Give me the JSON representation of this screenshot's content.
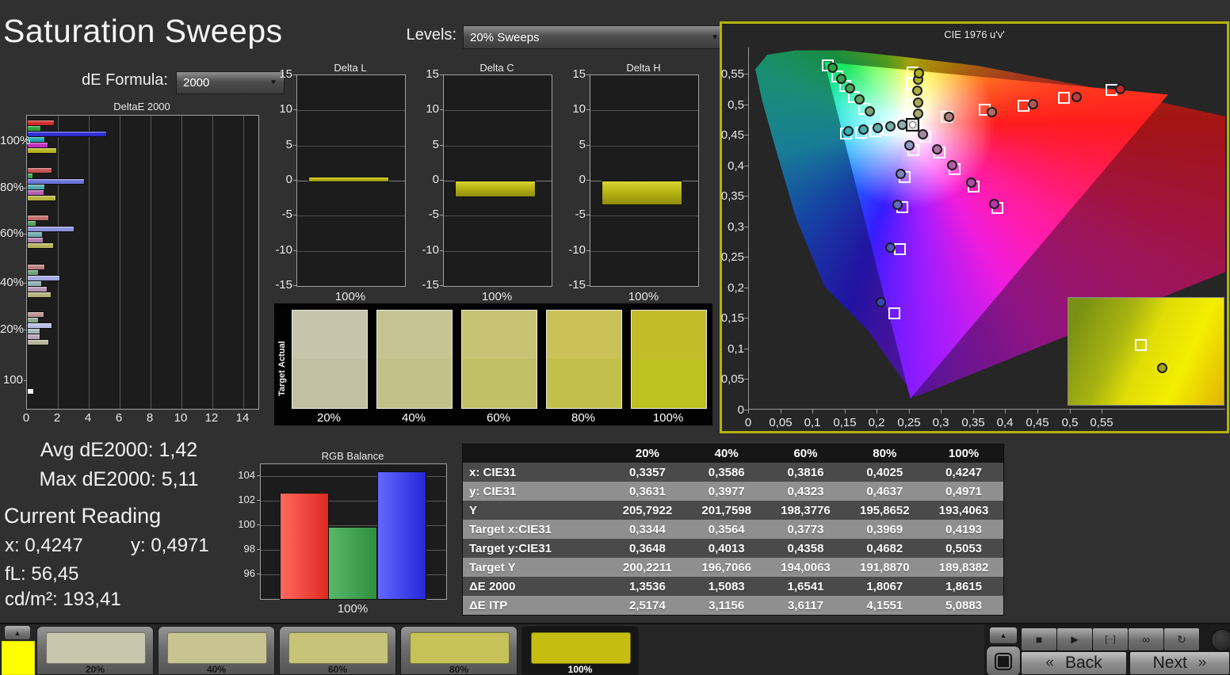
{
  "app": {
    "title": "Saturation Sweeps"
  },
  "controls": {
    "de_formula": {
      "label": "dE Formula:",
      "value": "2000"
    },
    "levels": {
      "label": "Levels:",
      "value": "20% Sweeps"
    }
  },
  "stats": {
    "avg": "Avg dE2000: 1,42",
    "max": "Max dE2000: 5,11",
    "current_reading": "Current Reading",
    "x_value": "x: 0,4247",
    "y_value": "y: 0,4971",
    "fl": "fL: 56,45",
    "cdm2": "cd/m²: 193,41"
  },
  "swatch_panel": {
    "row_labels": [
      "Actual",
      "Target"
    ],
    "columns": [
      {
        "label": "20%",
        "actual": "#c6c4ab",
        "target": "#c1c0a2"
      },
      {
        "label": "40%",
        "actual": "#c6c492",
        "target": "#c2c189"
      },
      {
        "label": "60%",
        "actual": "#c8c374",
        "target": "#c1c067"
      },
      {
        "label": "80%",
        "actual": "#cac256",
        "target": "#c2c04a"
      },
      {
        "label": "100%",
        "actual": "#c3bc2a",
        "target": "#bfc021"
      }
    ]
  },
  "table": {
    "col_headers": [
      "20%",
      "40%",
      "60%",
      "80%",
      "100%"
    ],
    "rows": [
      {
        "label": "x: CIE31",
        "values": [
          "0,3357",
          "0,3586",
          "0,3816",
          "0,4025",
          "0,4247"
        ]
      },
      {
        "label": "y: CIE31",
        "values": [
          "0,3631",
          "0,3977",
          "0,4323",
          "0,4637",
          "0,4971"
        ]
      },
      {
        "label": "Y",
        "values": [
          "205,7922",
          "201,7598",
          "198,3776",
          "195,8652",
          "193,4063"
        ]
      },
      {
        "label": "Target x:CIE31",
        "values": [
          "0,3344",
          "0,3564",
          "0,3773",
          "0,3969",
          "0,4193"
        ]
      },
      {
        "label": "Target y:CIE31",
        "values": [
          "0,3648",
          "0,4013",
          "0,4358",
          "0,4682",
          "0,5053"
        ]
      },
      {
        "label": "Target Y",
        "values": [
          "200,2211",
          "196,7066",
          "194,0063",
          "191,8870",
          "189,8382"
        ]
      },
      {
        "label": "ΔE 2000",
        "values": [
          "1,3536",
          "1,5083",
          "1,6541",
          "1,8067",
          "1,8615"
        ]
      },
      {
        "label": "ΔE ITP",
        "values": [
          "2,5174",
          "3,1156",
          "3,6117",
          "4,1551",
          "5,0883"
        ]
      }
    ]
  },
  "bottom_bar": {
    "current_color": "#ffff00",
    "tiles": [
      {
        "label": "20%",
        "color": "#c7c5ab",
        "selected": false
      },
      {
        "label": "40%",
        "color": "#c7c492",
        "selected": false
      },
      {
        "label": "60%",
        "color": "#c7c379",
        "selected": false
      },
      {
        "label": "80%",
        "color": "#c6c158",
        "selected": false
      },
      {
        "label": "100%",
        "color": "#c6bd12",
        "selected": true
      }
    ]
  },
  "transport": {
    "icons": [
      "stop",
      "play",
      "range",
      "infinity",
      "refresh"
    ],
    "glyphs": {
      "stop": "■",
      "play": "▶",
      "range": "[··]",
      "infinity": "∞",
      "refresh": "↻",
      "arrow_up": "▲"
    },
    "back_label": "Back",
    "next_label": "Next",
    "back_chevron": "«",
    "next_chevron": "»"
  },
  "chart_data": [
    {
      "id": "deltae2000",
      "type": "bar",
      "orientation": "horizontal",
      "title": "DeltaE 2000",
      "xlim": [
        0,
        15
      ],
      "xticks": [
        0,
        2,
        4,
        6,
        8,
        10,
        12,
        14
      ],
      "series_names": [
        "Red",
        "Green",
        "Blue",
        "Cyan",
        "Magenta",
        "Yellow"
      ],
      "groups": [
        {
          "label": "100%",
          "values": [
            1.7,
            0.8,
            5.11,
            1.1,
            1.3,
            1.85
          ],
          "colors": [
            "#d02c2c",
            "#2ca23c",
            "#2c2cd0",
            "#20a8b0",
            "#c02cc0",
            "#b6b31e"
          ]
        },
        {
          "label": "80%",
          "values": [
            1.55,
            0.3,
            3.65,
            1.1,
            1.05,
            1.8
          ],
          "colors": [
            "#c25454",
            "#3da04e",
            "#6b74d8",
            "#4faab0",
            "#b45cb4",
            "#b5b23c"
          ]
        },
        {
          "label": "60%",
          "values": [
            1.35,
            0.5,
            3.0,
            0.95,
            1.0,
            1.65
          ],
          "colors": [
            "#c06a6a",
            "#55a060",
            "#8a90dc",
            "#72acb0",
            "#b07cb0",
            "#b5b25c"
          ]
        },
        {
          "label": "40%",
          "values": [
            1.1,
            0.65,
            2.05,
            0.85,
            1.25,
            1.5
          ],
          "colors": [
            "#bd8080",
            "#6fa377",
            "#a3a8e0",
            "#8fb0b2",
            "#b493b4",
            "#b6b37c"
          ]
        },
        {
          "label": "20%",
          "values": [
            1.05,
            0.65,
            1.55,
            0.75,
            0.75,
            1.35
          ],
          "colors": [
            "#bb9494",
            "#8aa68e",
            "#b8bce4",
            "#a8b4b5",
            "#b5a6b5",
            "#b7b49a"
          ]
        },
        {
          "label": "100",
          "values": [
            0.35
          ],
          "colors": [
            "#f2f2f2"
          ]
        }
      ]
    },
    {
      "id": "delta_l",
      "type": "bar",
      "title": "Delta L",
      "categories": [
        "100%"
      ],
      "values": [
        0.55
      ],
      "ylim": [
        -15,
        15
      ],
      "yticks": [
        15,
        10,
        5,
        0,
        -5,
        -10,
        -15
      ],
      "bar_color": "#b9b61d"
    },
    {
      "id": "delta_c",
      "type": "bar",
      "title": "Delta C",
      "categories": [
        "100%"
      ],
      "values": [
        -2.1
      ],
      "ylim": [
        -15,
        15
      ],
      "yticks": [
        15,
        10,
        5,
        0,
        -5,
        -10,
        -15
      ],
      "bar_color": "#b9b61d"
    },
    {
      "id": "delta_h",
      "type": "bar",
      "title": "Delta H",
      "categories": [
        "100%"
      ],
      "values": [
        -3.3
      ],
      "ylim": [
        -15,
        15
      ],
      "yticks": [
        15,
        10,
        5,
        0,
        -5,
        -10,
        -15
      ],
      "bar_color": "#b9b61d"
    },
    {
      "id": "rgb_balance",
      "type": "bar",
      "title": "RGB Balance",
      "categories": [
        "100%"
      ],
      "ylim": [
        94,
        105
      ],
      "yticks": [
        104,
        102,
        100,
        98,
        96
      ],
      "series": [
        {
          "name": "Red",
          "value": 102.7,
          "color": "#ff6a5e",
          "color2": "#e02a22"
        },
        {
          "name": "Green",
          "value": 99.9,
          "color": "#58b868",
          "color2": "#2f8f40"
        },
        {
          "name": "Blue",
          "value": 104.4,
          "color": "#6468ff",
          "color2": "#2626d8"
        }
      ]
    },
    {
      "id": "cie1976",
      "type": "scatter",
      "title": "CIE 1976 u'v'",
      "xticks": [
        "0",
        "0,05",
        "0,1",
        "0,15",
        "0,2",
        "0,25",
        "0,3",
        "0,35",
        "0,4",
        "0,45",
        "0,5",
        "0,55"
      ],
      "yticks": [
        "0",
        "0,05",
        "0,1",
        "0,15",
        "0,2",
        "0,25",
        "0,3",
        "0,35",
        "0,4",
        "0,45",
        "0,5",
        "0,55"
      ],
      "tick_step": 0.05,
      "white_point": {
        "u": 0.255,
        "v": 0.467
      },
      "sweeps": [
        {
          "name": "red",
          "targets": [
            [
              0.308,
              0.48
            ],
            [
              0.367,
              0.492
            ],
            [
              0.428,
              0.498
            ],
            [
              0.491,
              0.511
            ],
            [
              0.565,
              0.524
            ]
          ],
          "measured": [
            [
              0.312,
              0.48
            ],
            [
              0.379,
              0.488
            ],
            [
              0.443,
              0.501
            ],
            [
              0.51,
              0.512
            ],
            [
              0.578,
              0.525
            ]
          ],
          "colors": [
            "#b08080",
            "#b46a6a",
            "#b85454",
            "#bc3e3e",
            "#c02828"
          ]
        },
        {
          "name": "green",
          "targets": [
            [
              0.18,
              0.493
            ],
            [
              0.164,
              0.512
            ],
            [
              0.15,
              0.531
            ],
            [
              0.138,
              0.546
            ],
            [
              0.123,
              0.564
            ]
          ],
          "measured": [
            [
              0.189,
              0.489
            ],
            [
              0.173,
              0.508
            ],
            [
              0.158,
              0.527
            ],
            [
              0.144,
              0.542
            ],
            [
              0.131,
              0.56
            ]
          ],
          "colors": [
            "#7ca477",
            "#63a468",
            "#4aa25a",
            "#37a34e",
            "#2aa344"
          ]
        },
        {
          "name": "blue",
          "targets": [
            [
              0.256,
              0.425
            ],
            [
              0.243,
              0.381
            ],
            [
              0.239,
              0.332
            ],
            [
              0.236,
              0.263
            ],
            [
              0.227,
              0.158
            ]
          ],
          "measured": [
            [
              0.25,
              0.433
            ],
            [
              0.237,
              0.387
            ],
            [
              0.232,
              0.336
            ],
            [
              0.221,
              0.266
            ],
            [
              0.206,
              0.176
            ]
          ],
          "colors": [
            "#9298c4",
            "#7a82c2",
            "#626cc0",
            "#4c58be",
            "#3846bc"
          ]
        },
        {
          "name": "cyan",
          "targets": [
            [
              0.236,
              0.463
            ],
            [
              0.217,
              0.459
            ],
            [
              0.197,
              0.457
            ],
            [
              0.175,
              0.454
            ],
            [
              0.152,
              0.453
            ]
          ],
          "measured": [
            [
              0.239,
              0.467
            ],
            [
              0.221,
              0.464
            ],
            [
              0.201,
              0.462
            ],
            [
              0.179,
              0.459
            ],
            [
              0.155,
              0.457
            ]
          ],
          "colors": [
            "#8fb0ac",
            "#79b0ae",
            "#62b0b0",
            "#4cb0b2",
            "#38b0b4"
          ]
        },
        {
          "name": "magenta",
          "targets": [
            [
              0.275,
              0.447
            ],
            [
              0.297,
              0.422
            ],
            [
              0.321,
              0.394
            ],
            [
              0.35,
              0.366
            ],
            [
              0.387,
              0.331
            ]
          ],
          "measured": [
            [
              0.271,
              0.451
            ],
            [
              0.293,
              0.427
            ],
            [
              0.317,
              0.401
            ],
            [
              0.346,
              0.372
            ],
            [
              0.382,
              0.337
            ]
          ],
          "colors": [
            "#ab86a4",
            "#ad72a6",
            "#b05ea8",
            "#b34aaa",
            "#b637ac"
          ]
        },
        {
          "name": "yellow",
          "targets": [
            [
              0.254,
              0.48
            ],
            [
              0.254,
              0.498
            ],
            [
              0.254,
              0.516
            ],
            [
              0.254,
              0.534
            ],
            [
              0.255,
              0.552
            ]
          ],
          "measured": [
            [
              0.264,
              0.485
            ],
            [
              0.264,
              0.503
            ],
            [
              0.263,
              0.523
            ],
            [
              0.264,
              0.541
            ],
            [
              0.265,
              0.551
            ]
          ],
          "colors": [
            "#aaa76a",
            "#adaa55",
            "#b0ac41",
            "#b3ae2c",
            "#b6b01a"
          ]
        }
      ],
      "inset": {
        "target_color": "#ffffff",
        "measured_color": "#a8a018"
      }
    }
  ]
}
